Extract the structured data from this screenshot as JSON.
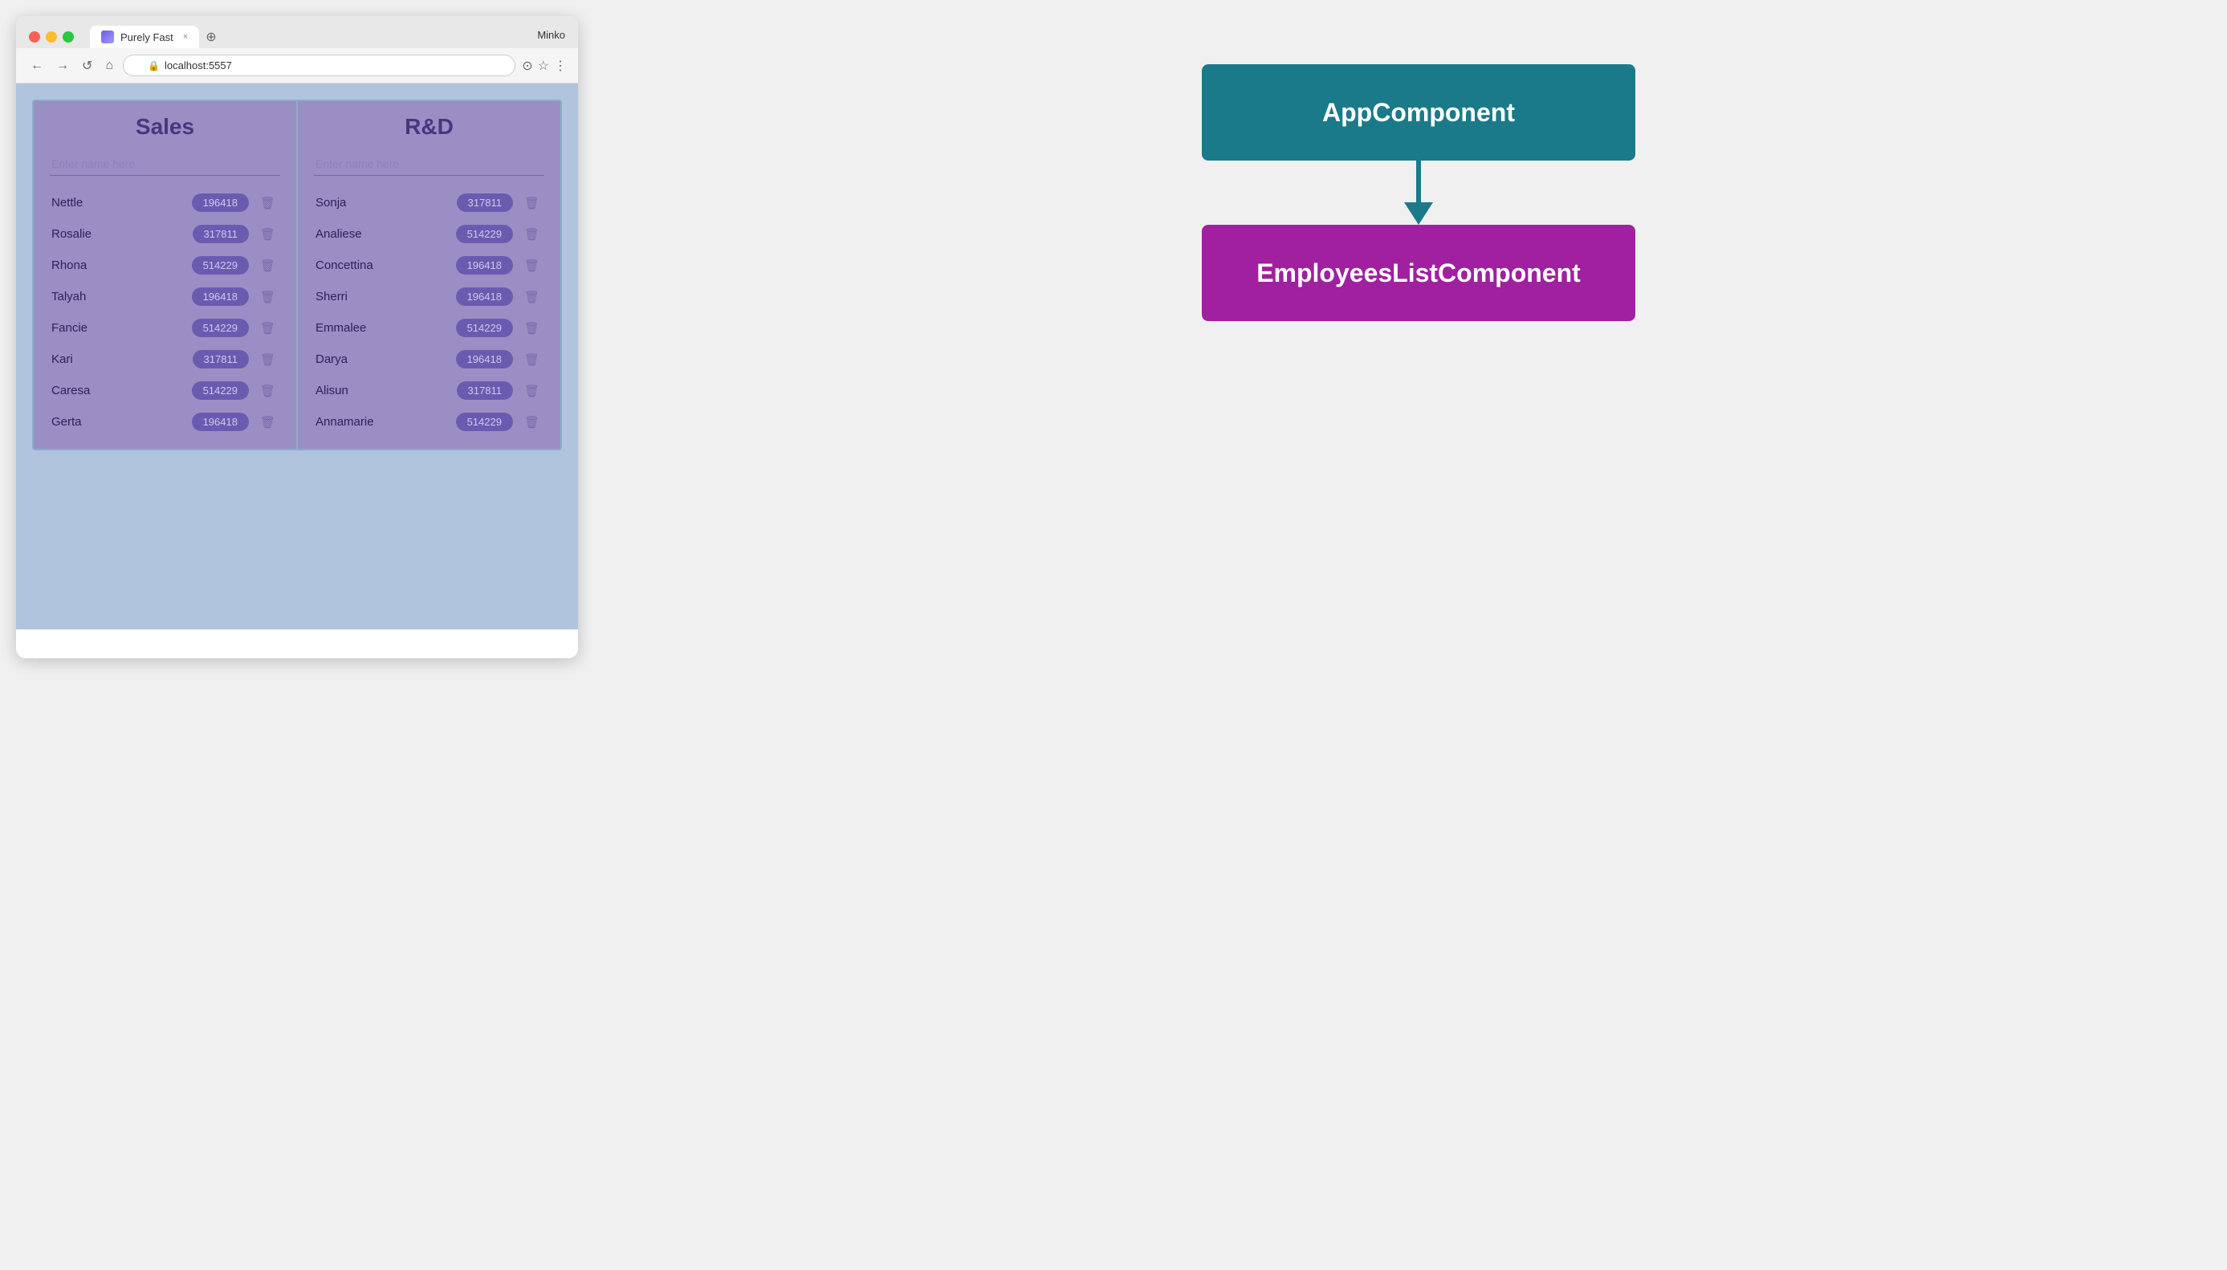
{
  "browser": {
    "tab_title": "Purely Fast",
    "tab_close": "×",
    "url": "localhost:5557",
    "user": "Minko",
    "new_tab_label": "⊕"
  },
  "nav": {
    "back": "←",
    "forward": "→",
    "reload": "↺",
    "home": "⌂"
  },
  "sales": {
    "title": "Sales",
    "input_placeholder": "Enter name here",
    "employees": [
      {
        "name": "Nettle",
        "badge": "196418"
      },
      {
        "name": "Rosalie",
        "badge": "317811"
      },
      {
        "name": "Rhona",
        "badge": "514229"
      },
      {
        "name": "Talyah",
        "badge": "196418"
      },
      {
        "name": "Fancie",
        "badge": "514229"
      },
      {
        "name": "Kari",
        "badge": "317811"
      },
      {
        "name": "Caresa",
        "badge": "514229"
      },
      {
        "name": "Gerta",
        "badge": "196418"
      }
    ]
  },
  "rd": {
    "title": "R&D",
    "input_placeholder": "Enter name here",
    "employees": [
      {
        "name": "Sonja",
        "badge": "317811"
      },
      {
        "name": "Analiese",
        "badge": "514229"
      },
      {
        "name": "Concettina",
        "badge": "196418"
      },
      {
        "name": "Sherri",
        "badge": "196418"
      },
      {
        "name": "Emmalee",
        "badge": "514229"
      },
      {
        "name": "Darya",
        "badge": "196418"
      },
      {
        "name": "Alisun",
        "badge": "317811"
      },
      {
        "name": "Annamarie",
        "badge": "514229"
      }
    ]
  },
  "diagram": {
    "app_component_label": "AppComponent",
    "employees_component_label": "EmployeesListComponent"
  }
}
